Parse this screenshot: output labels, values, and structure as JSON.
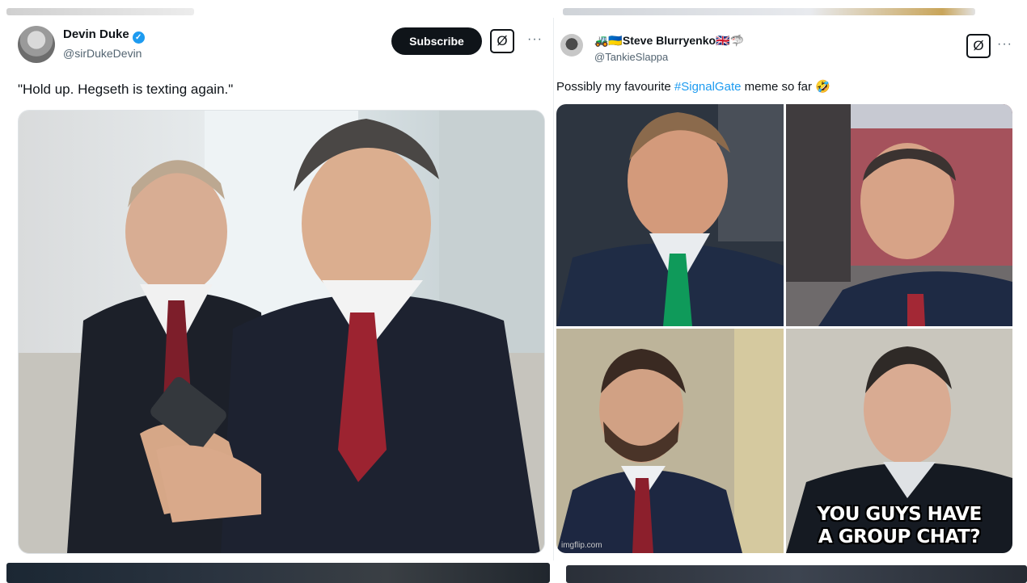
{
  "left_post": {
    "author_name": "Devin Duke",
    "author_handle": "@sirDukeDevin",
    "subscribe_label": "Subscribe",
    "grok_label": "Ø",
    "more_label": "···",
    "text": "\"Hold up. Hegseth is texting again.\"",
    "verified_color": "#1d9bf0"
  },
  "right_post": {
    "author_name": "Steve Blurryenko",
    "author_prefix_emoji": "🚜🇺🇦",
    "author_suffix_emoji": "🇬🇧🦈",
    "author_handle": "@TankieSlappa",
    "grok_label": "Ø",
    "more_label": "···",
    "text_before": "Possibly my favourite ",
    "hashtag": "#SignalGate",
    "text_after": " meme so far 🤣",
    "meme_caption_line1": "YOU GUYS HAVE",
    "meme_caption_line2": "A GROUP CHAT?",
    "watermark": "imgflip.com"
  },
  "colors": {
    "hashtag": "#1d9bf0",
    "handle": "#536471",
    "button_dark": "#0f1419"
  }
}
